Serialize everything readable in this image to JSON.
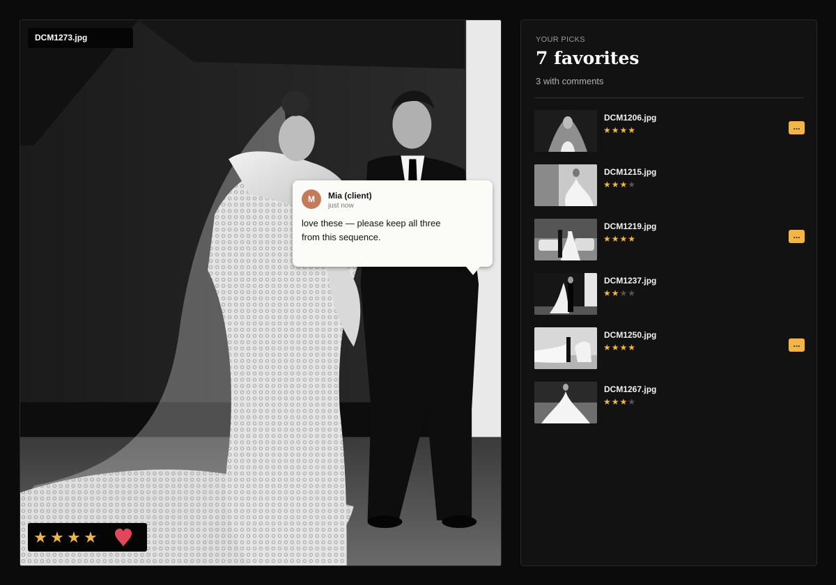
{
  "viewer": {
    "filename": "DCM1273.jpg",
    "rating": 4,
    "favorited": true,
    "icons": {
      "star": "star-icon",
      "heart": "heart-icon"
    }
  },
  "comment": {
    "avatar_initial": "M",
    "author": "Mia (client)",
    "time": "just now",
    "text": "love these — please keep all three from this sequence."
  },
  "picks": {
    "eyebrow": "YOUR PICKS",
    "title": "7 favorites",
    "subtitle": "3 with comments",
    "items": [
      {
        "name": "DCM1206.jpg",
        "rating": 4,
        "has_comment": true,
        "badge": "..."
      },
      {
        "name": "DCM1215.jpg",
        "rating": 3,
        "has_comment": false
      },
      {
        "name": "DCM1219.jpg",
        "rating": 4,
        "has_comment": true,
        "badge": "..."
      },
      {
        "name": "DCM1237.jpg",
        "rating": 2,
        "has_comment": false
      },
      {
        "name": "DCM1250.jpg",
        "rating": 4,
        "has_comment": true,
        "badge": "..."
      },
      {
        "name": "DCM1267.jpg",
        "rating": 3,
        "has_comment": false
      }
    ]
  },
  "colors": {
    "accent_star": "#f2b54a",
    "heart": "#e0485a",
    "avatar": "#c47a5c",
    "background": "#0b0b0b"
  }
}
